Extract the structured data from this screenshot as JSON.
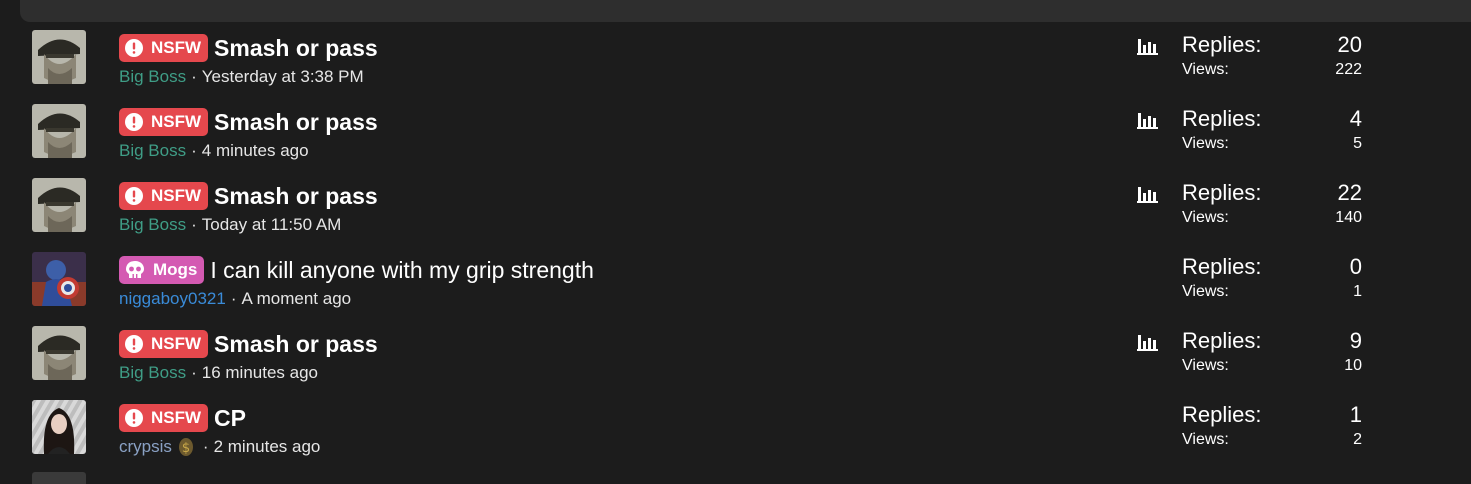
{
  "threads": [
    {
      "avatar": "big-boss-avatar",
      "prefix": "NSFW",
      "prefix_type": "nsfw",
      "title": "Smash or pass",
      "title_bold": true,
      "author": "Big Boss",
      "author_style": "green",
      "time": "Yesterday at 3:38 PM",
      "poll": true,
      "replies_label": "Replies:",
      "replies": "20",
      "views_label": "Views:",
      "views": "222"
    },
    {
      "avatar": "big-boss-avatar",
      "prefix": "NSFW",
      "prefix_type": "nsfw",
      "title": "Smash or pass",
      "title_bold": true,
      "author": "Big Boss",
      "author_style": "green",
      "time": "4 minutes ago",
      "poll": true,
      "replies_label": "Replies:",
      "replies": "4",
      "views_label": "Views:",
      "views": "5"
    },
    {
      "avatar": "big-boss-avatar",
      "prefix": "NSFW",
      "prefix_type": "nsfw",
      "title": "Smash or pass",
      "title_bold": true,
      "author": "Big Boss",
      "author_style": "green",
      "time": "Today at 11:50 AM",
      "poll": true,
      "replies_label": "Replies:",
      "replies": "22",
      "views_label": "Views:",
      "views": "140"
    },
    {
      "avatar": "captain-avatar",
      "prefix": "Mogs",
      "prefix_type": "mogs",
      "title": "I can kill anyone with my grip strength",
      "title_bold": false,
      "author": "niggaboy0321",
      "author_style": "blue",
      "time": "A moment ago",
      "poll": false,
      "replies_label": "Replies:",
      "replies": "0",
      "views_label": "Views:",
      "views": "1"
    },
    {
      "avatar": "big-boss-avatar",
      "prefix": "NSFW",
      "prefix_type": "nsfw",
      "title": "Smash or pass",
      "title_bold": true,
      "author": "Big Boss",
      "author_style": "green",
      "time": "16 minutes ago",
      "poll": true,
      "replies_label": "Replies:",
      "replies": "9",
      "views_label": "Views:",
      "views": "10"
    },
    {
      "avatar": "woman-avatar",
      "prefix": "NSFW",
      "prefix_type": "nsfw",
      "title": "CP",
      "title_bold": true,
      "author": "crypsis",
      "author_style": "slate",
      "author_badge": "coin-icon",
      "time": "2 minutes ago",
      "poll": false,
      "replies_label": "Replies:",
      "replies": "1",
      "views_label": "Views:",
      "views": "2"
    }
  ],
  "meta_separator": "·",
  "colors": {
    "background": "#1c1c1c",
    "nsfw_badge": "#e5484d",
    "mogs_badge": "#d45ab2",
    "author_green": "#3f9d86",
    "author_blue": "#3a8bd8"
  }
}
